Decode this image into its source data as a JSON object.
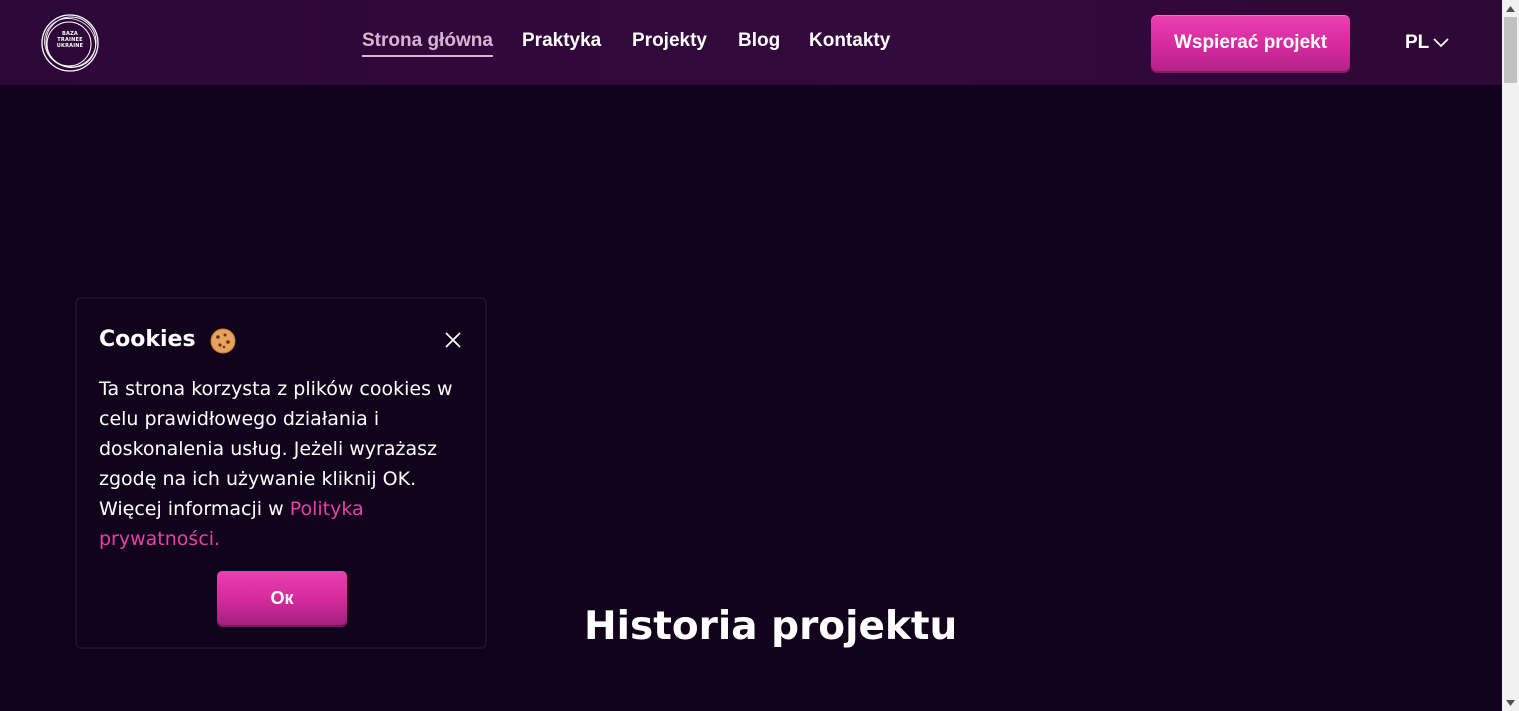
{
  "header": {
    "logo": {
      "lines": [
        "BAZA",
        "TRAINEE",
        "UKRAINE"
      ],
      "icon": "baza-trainee-logo"
    },
    "nav": [
      {
        "label": "Strona główna",
        "active": true
      },
      {
        "label": "Praktyka",
        "active": false
      },
      {
        "label": "Projekty",
        "active": false
      },
      {
        "label": "Blog",
        "active": false
      },
      {
        "label": "Kontakty",
        "active": false
      }
    ],
    "support_button": "Wspierać projekt",
    "language": {
      "selected": "PL",
      "icon": "chevron-down-icon"
    }
  },
  "cookie_banner": {
    "title": "Cookies",
    "title_icon": "cookie-icon",
    "text": "Ta strona korzysta z plików cookies w celu prawidłowego działania i doskonalenia usług. Jeżeli wyrażasz zgodę na ich używanie kliknij OK. Więcej informacji w",
    "link": "Polityka prywatności.",
    "ok_button": "Ок",
    "close_icon": "close-icon"
  },
  "main": {
    "section_title": "Historia projektu"
  },
  "colors": {
    "accent": "#e33aac",
    "background": "#12031d",
    "header_background": "#2c0838",
    "link": "#e840a8",
    "active_nav": "#d9b3d4"
  }
}
